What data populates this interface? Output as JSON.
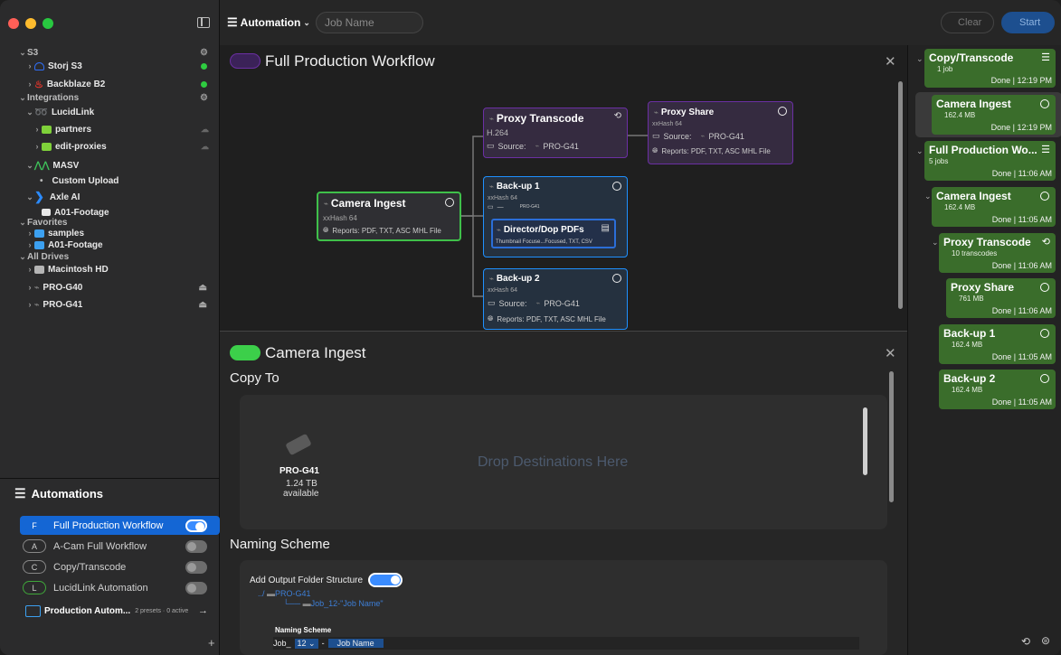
{
  "toolbar": {
    "automation_label": "Automation",
    "job_name_placeholder": "Job Name",
    "clear_label": "Clear",
    "start_label": "Start"
  },
  "sidebar": {
    "s3_label": "S3",
    "storj": "Storj S3",
    "backblaze": "Backblaze B2",
    "integrations_label": "Integrations",
    "lucidlink": "LucidLink",
    "partners": "partners",
    "edit_proxies": "edit-proxies",
    "masv": "MASV",
    "custom_upload": "Custom Upload",
    "axle": "Axle AI",
    "a01_footage_axle": "A01-Footage",
    "favorites_label": "Favorites",
    "samples": "samples",
    "a01_footage_fav": "A01-Footage",
    "all_drives_label": "All Drives",
    "macintosh_hd": "Macintosh HD",
    "pro_g40": "PRO-G40",
    "pro_g41": "PRO-G41"
  },
  "automations": {
    "title": "Automations",
    "items": [
      {
        "letter": "F",
        "label": "Full Production Workflow",
        "on": true
      },
      {
        "letter": "A",
        "label": "A-Cam Full Workflow",
        "on": false
      },
      {
        "letter": "C",
        "label": "Copy/Transcode",
        "on": false
      },
      {
        "letter": "L",
        "label": "LucidLink Automation",
        "on": false
      }
    ],
    "folder_label": "Production Autom...",
    "folder_meta": "2 presets · 0 active",
    "add_label": "+"
  },
  "workflow": {
    "title": "Full Production Workflow",
    "camera_ingest": {
      "title": "Camera Ingest",
      "hash": "xxHash 64",
      "reports": "Reports: PDF, TXT, ASC MHL File"
    },
    "proxy_transcode": {
      "title": "Proxy Transcode",
      "codec": "H.264",
      "source_label": "Source:",
      "source": "PRO-G41"
    },
    "proxy_share": {
      "title": "Proxy Share",
      "hash": "xxHash 64",
      "source_label": "Source:",
      "source": "PRO-G41",
      "reports": "Reports: PDF, TXT, ASC MHL File"
    },
    "backup1": {
      "title": "Back-up 1",
      "hash": "xxHash 64",
      "folder": "—",
      "drive": "PRO-G41"
    },
    "director": {
      "title": "Director/Dop PDFs",
      "detail": "Thumbnail Focuse...Focused, TXT, CSV"
    },
    "backup2": {
      "title": "Back-up 2",
      "hash": "xxHash 64",
      "source_label": "Source:",
      "source": "PRO-G41",
      "reports": "Reports: PDF, TXT, ASC MHL File"
    }
  },
  "detail": {
    "title": "Camera Ingest",
    "copy_to": "Copy To",
    "drive_name": "PRO-G41",
    "drive_size": "1.24 TB",
    "drive_avail": "available",
    "drop_text": "Drop Destinations Here",
    "naming_scheme": "Naming Scheme",
    "add_output": "Add Output Folder Structure",
    "tree_root": "PRO-G41",
    "tree_child": "Job_12-\"Job Name\"",
    "ns_label": "Naming Scheme",
    "ns_prefix": "Job_",
    "ns_number": "12",
    "ns_sep": "-",
    "ns_token": "Job Name"
  },
  "jobs": [
    {
      "title": "Copy/Transcode",
      "sub": "1 job",
      "status": "Done | 12:19 PM"
    },
    {
      "title": "Camera Ingest",
      "sub": "162.4 MB",
      "status": "Done | 12:19 PM"
    },
    {
      "title": "Full Production Wo...",
      "sub": "5 jobs",
      "status": "Done | 11:06 AM"
    },
    {
      "title": "Camera Ingest",
      "sub": "162.4 MB",
      "status": "Done | 11:05 AM"
    },
    {
      "title": "Proxy Transcode",
      "sub": "10 transcodes",
      "status": "Done | 11:06 AM"
    },
    {
      "title": "Proxy Share",
      "sub": "761 MB",
      "status": "Done | 11:06 AM"
    },
    {
      "title": "Back-up 1",
      "sub": "162.4 MB",
      "status": "Done | 11:05 AM"
    },
    {
      "title": "Back-up 2",
      "sub": "162.4 MB",
      "status": "Done | 11:05 AM"
    }
  ],
  "colors": {
    "accent": "#1466d4",
    "green": "#3a6d2b",
    "purple": "#6b2fa3",
    "blue": "#1e90ff"
  }
}
